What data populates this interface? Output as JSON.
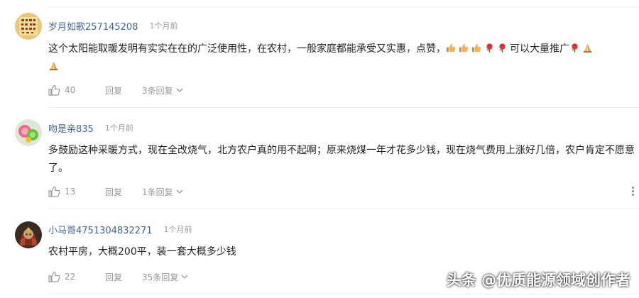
{
  "comments": [
    {
      "username": "岁月如歌257145208",
      "time": "1个月前",
      "text": "这个太阳能取暖发明有实实在在的广泛使用性，在农村，一般家庭都能承受又实惠，点赞，",
      "emoji_tail": [
        "thumbs-up",
        "thumbs-up",
        "thumbs-up",
        "rose",
        "rose"
      ],
      "text_after_emoji": "可以大量推广",
      "emoji_end": [
        "rose",
        "praying-hands",
        "praying-hands"
      ],
      "likes": "40",
      "reply_label": "回复",
      "replies_label": "3条回复"
    },
    {
      "username": "吻是亲835",
      "time": "1个月前",
      "text": "多鼓励这种采暖方式，现在全改烧气，北方农户真的用不起啊；原来烧煤一年才花多少钱，现在烧气费用上涨好几倍，农户肯定不愿意了。",
      "likes": "13",
      "reply_label": "回复",
      "replies_label": "1条回复"
    },
    {
      "username": "小马哥4751304832271",
      "time": "1个月前",
      "text": "农村平房，大概200平，装一套大概多少钱",
      "likes": "22",
      "reply_label": "回复",
      "replies_label": "35条回复"
    }
  ],
  "watermark": "头条 @优质能源领域创作者",
  "colors": {
    "username": "#406599",
    "muted": "#999999",
    "text": "#222222",
    "divider": "#ececec"
  }
}
